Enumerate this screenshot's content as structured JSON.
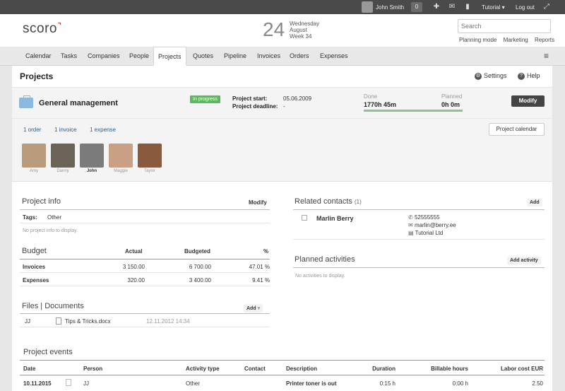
{
  "topbar": {
    "user_name": "John Smith",
    "notification_count": "0",
    "tutorial_label": "Tutorial",
    "logout_label": "Log out"
  },
  "header": {
    "logo": "scoro",
    "day_number": "24",
    "weekday": "Wednesday",
    "month": "August",
    "week": "Week 34",
    "search_placeholder": "Search",
    "links": [
      "Planning mode",
      "Marketing",
      "Reports"
    ]
  },
  "nav": {
    "tabs": [
      "Calendar",
      "Tasks",
      "Companies",
      "People",
      "Projects",
      "Quotes",
      "Pipeline",
      "Invoices",
      "Orders",
      "Expenses"
    ],
    "active": "Projects"
  },
  "page": {
    "title": "Projects",
    "settings_label": "Settings",
    "help_label": "Help"
  },
  "project": {
    "name": "General management",
    "status": "In progress",
    "start_label": "Project start:",
    "start_value": "05.06.2009",
    "deadline_label": "Project deadline:",
    "deadline_value": "-",
    "done_label": "Done",
    "done_value": "1770h 45m",
    "planned_label": "Planned",
    "planned_value": "0h 0m",
    "progress_fraction": 1.0,
    "modify_label": "Modify",
    "links": [
      "1 order",
      "1 invoice",
      "1 expense"
    ],
    "calendar_button": "Project calendar"
  },
  "people": [
    {
      "name": "Amy",
      "bold": false,
      "color": "#b99a7a"
    },
    {
      "name": "Danny",
      "bold": false,
      "color": "#6b6258"
    },
    {
      "name": "John",
      "bold": true,
      "color": "#7b7b7b"
    },
    {
      "name": "Maggie",
      "bold": false,
      "color": "#c9a083"
    },
    {
      "name": "Taylor",
      "bold": false,
      "color": "#8a5a3e"
    }
  ],
  "project_info": {
    "title": "Project info",
    "modify_label": "Modify",
    "tags_label": "Tags:",
    "tags_value": "Other",
    "empty_text": "No project info to display."
  },
  "budget": {
    "title": "Budget",
    "columns": [
      "Actual",
      "Budgeted",
      "%"
    ],
    "rows": [
      {
        "label": "Invoices",
        "actual": "3 150.00",
        "budgeted": "6 700.00",
        "pct": "47.01 %"
      },
      {
        "label": "Expenses",
        "actual": "320.00",
        "budgeted": "3 400.00",
        "pct": "9.41 %"
      }
    ]
  },
  "files": {
    "title": "Files | Documents",
    "add_label": "Add",
    "rows": [
      {
        "owner": "JJ",
        "name": "Tips & Tricks.docx",
        "date": "12.11.2012 14:34"
      }
    ]
  },
  "related_contacts": {
    "title": "Related contacts",
    "count": "(1)",
    "add_label": "Add",
    "contact": {
      "name": "Marlin Berry",
      "phone": "52555555",
      "email": "marlin@berry.ee",
      "company": "Tutorial Ltd"
    }
  },
  "planned_activities": {
    "title": "Planned activities",
    "add_label": "Add activity",
    "empty_text": "No activities to display."
  },
  "events": {
    "title": "Project events",
    "columns": [
      "Date",
      "Person",
      "Activity type",
      "Contact",
      "Description",
      "Duration",
      "Billable hours",
      "Labor cost EUR"
    ],
    "rows": [
      {
        "date": "10.11.2015",
        "person": "JJ",
        "type": "Other",
        "contact": "",
        "description": "Printer toner is out",
        "duration": "0:15 h",
        "billable": "0:00 h",
        "cost": "2.50"
      }
    ]
  }
}
